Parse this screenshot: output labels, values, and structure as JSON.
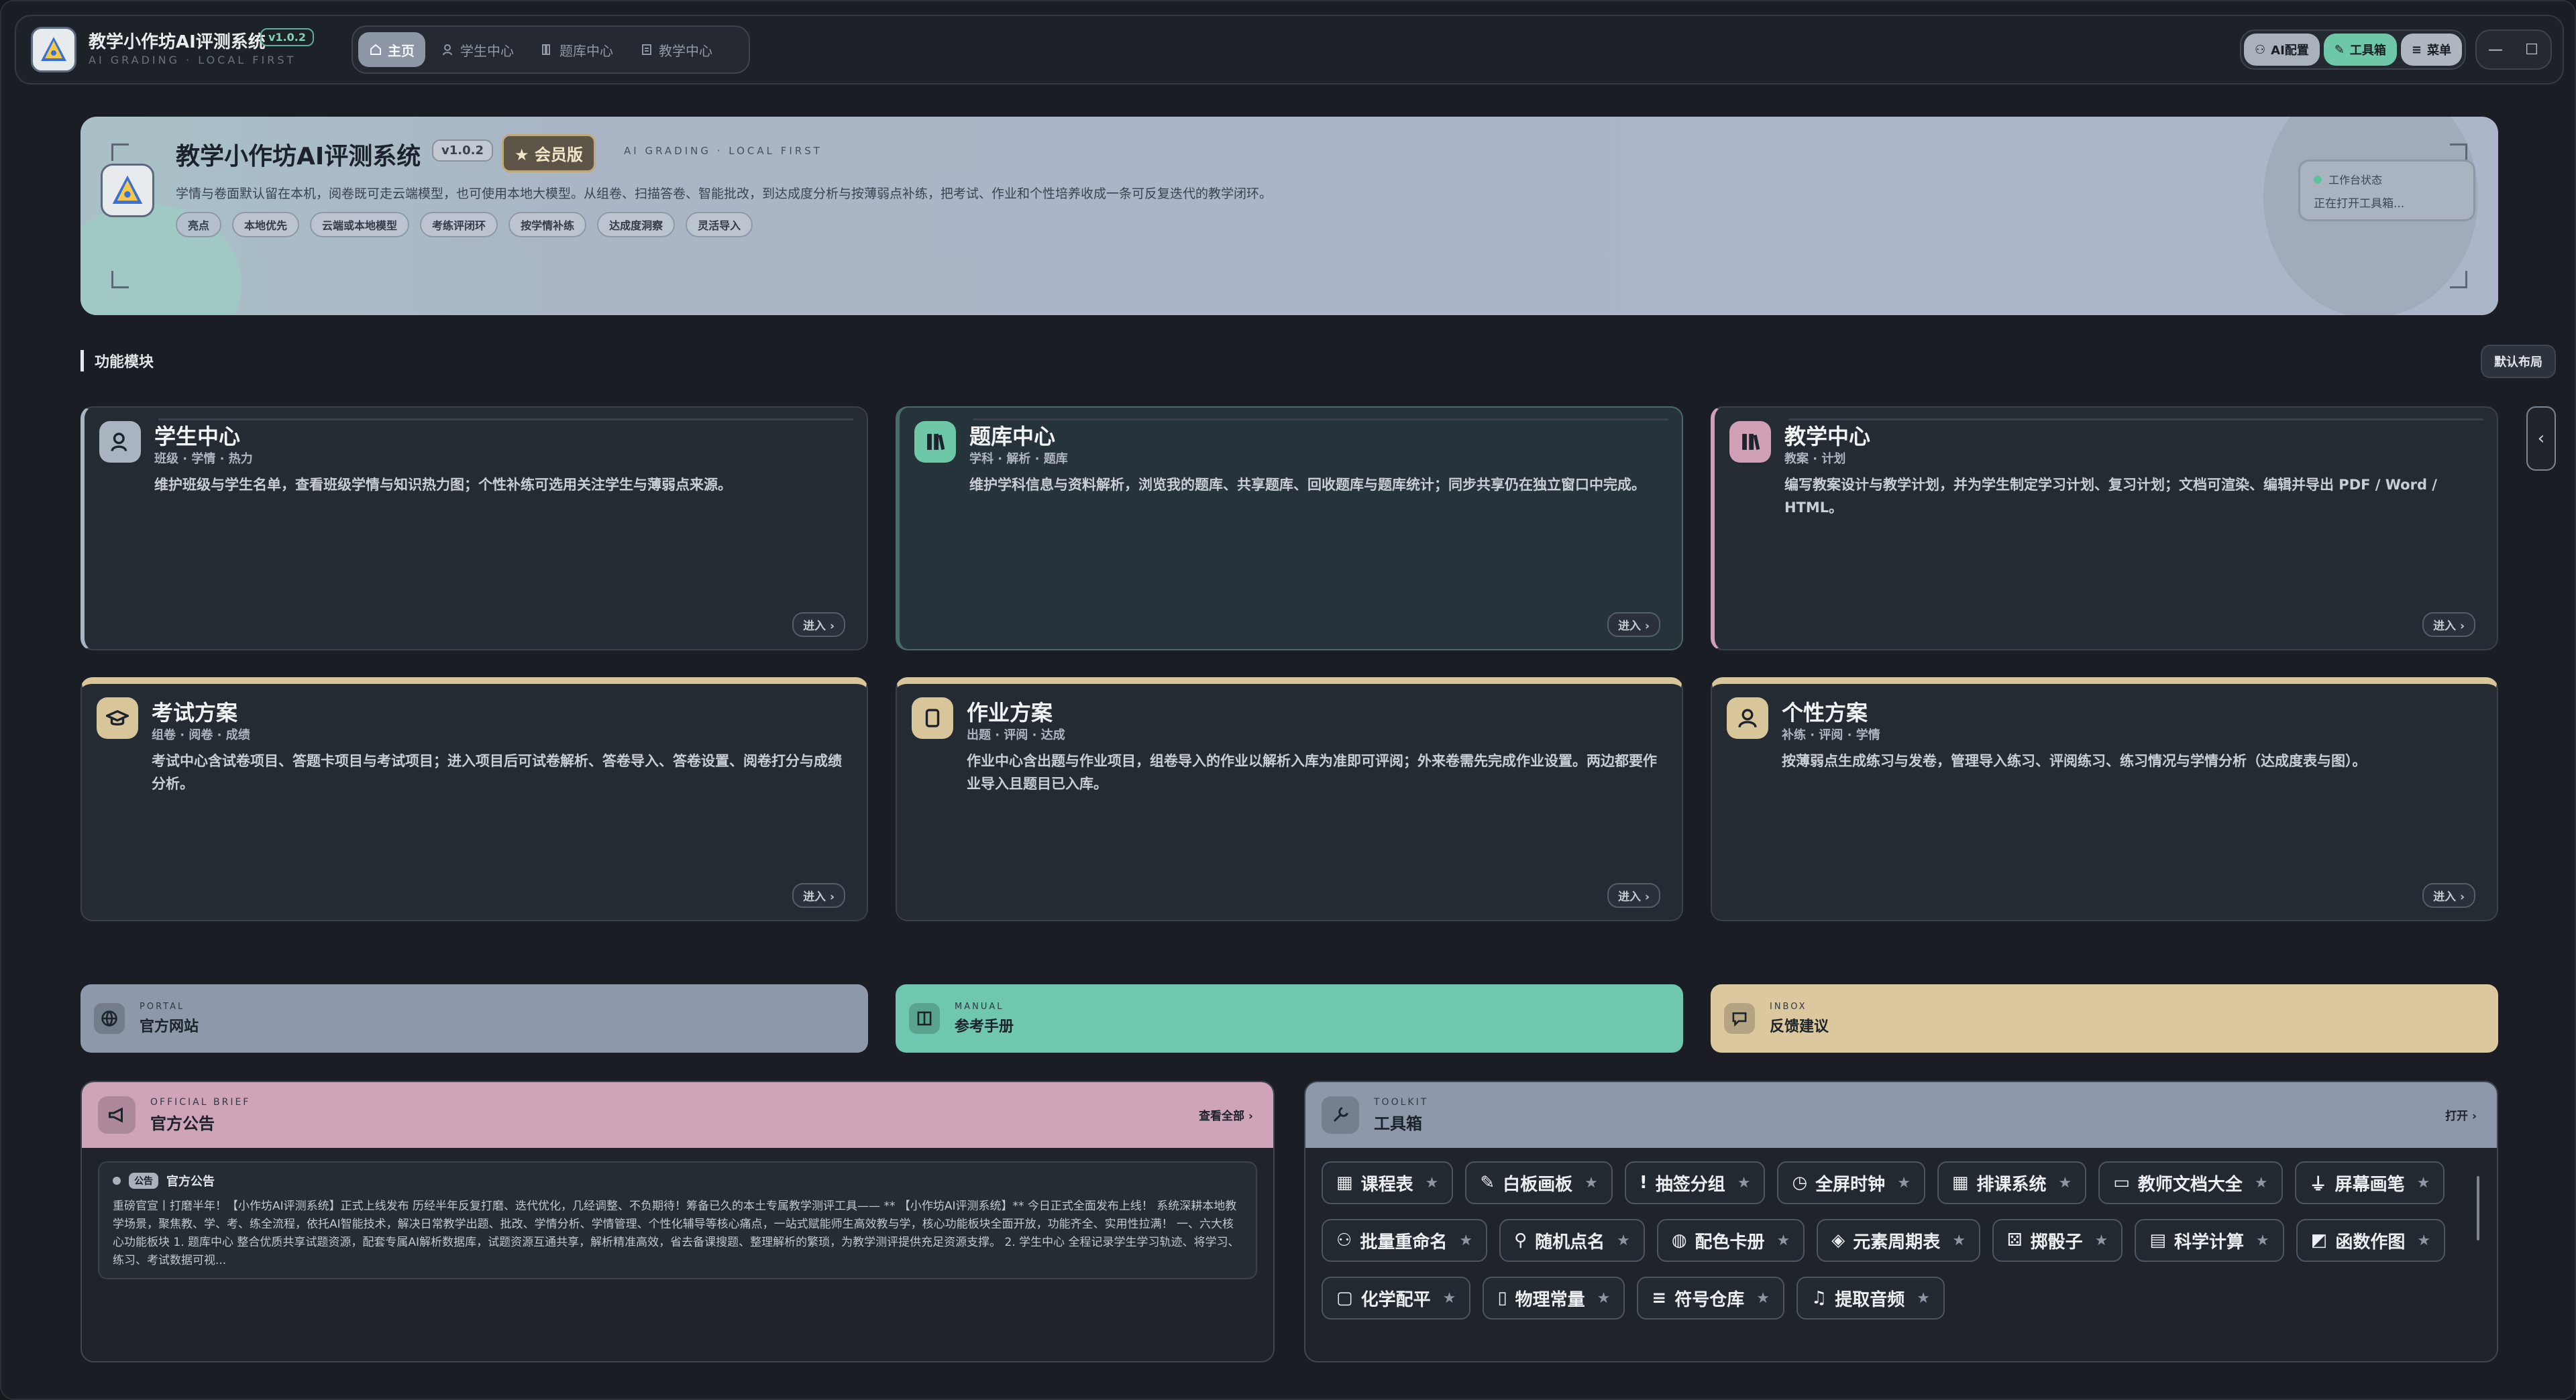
{
  "app": {
    "title": "教学小作坊AI评测系统",
    "version": "v1.0.2",
    "subtitle": "AI GRADING · LOCAL FIRST"
  },
  "nav": {
    "items": [
      {
        "label": "主页",
        "icon": "home-icon",
        "active": true
      },
      {
        "label": "学生中心",
        "icon": "student-icon",
        "active": false
      },
      {
        "label": "题库中心",
        "icon": "books-icon",
        "active": false
      },
      {
        "label": "教学中心",
        "icon": "doc-icon",
        "active": false
      }
    ]
  },
  "toolbar": {
    "ai_config": "AI配置",
    "toolbox": "工具箱",
    "menu": "菜单"
  },
  "hero": {
    "title": "教学小作坊AI评测系统",
    "version": "v1.0.2",
    "vip": "★ 会员版",
    "en": "AI GRADING · LOCAL FIRST",
    "desc": "学情与卷面默认留在本机，阅卷既可走云端模型，也可使用本地大模型。从组卷、扫描答卷、智能批改，到达成度分析与按薄弱点补练，把考试、作业和个性培养收成一条可反复迭代的教学闭环。",
    "tags": [
      "亮点",
      "本地优先",
      "云端或本地模型",
      "考练评闭环",
      "按学情补练",
      "达成度洞察",
      "灵活导入"
    ],
    "status_key": "工作台状态",
    "status_value": "正在打开工具箱..."
  },
  "section": {
    "label": "功能模块",
    "default_layout": "默认布局"
  },
  "modules": [
    {
      "title": "学生中心",
      "sub": "班级 · 学情 · 热力",
      "desc": "维护班级与学生名单，查看班级学情与知识热力图；个性补练可选用关注学生与薄弱点来源。",
      "enter": "进入",
      "icon": "student-icon",
      "color": "#aab3c0"
    },
    {
      "title": "题库中心",
      "sub": "学科 · 解析 · 题库",
      "desc": "维护学科信息与资料解析，浏览我的题库、共享题库、回收题库与题库统计；同步共享仍在独立窗口中完成。",
      "enter": "进入",
      "icon": "books-icon",
      "color": "#6ec7a6"
    },
    {
      "title": "教学中心",
      "sub": "教案 · 计划",
      "desc": "编写教案设计与教学计划，并为学生制定学习计划、复习计划；文档可渲染、编辑并导出 PDF / Word / HTML。",
      "enter": "进入",
      "icon": "books-icon",
      "color": "#cfa0b6"
    },
    {
      "title": "考试方案",
      "sub": "组卷 · 阅卷 · 成绩",
      "desc": "考试中心含试卷项目、答题卡项目与考试项目；进入项目后可试卷解析、答卷导入、答卷设置、阅卷打分与成绩分析。",
      "enter": "进入",
      "icon": "grad-cap-icon",
      "color": "#d9c59a"
    },
    {
      "title": "作业方案",
      "sub": "出题 · 评阅 · 达成",
      "desc": "作业中心含出题与作业项目，组卷导入的作业以解析入库为准即可评阅；外来卷需先完成作业设置。两边都要作业导入且题目已入库。",
      "enter": "进入",
      "icon": "tablet-icon",
      "color": "#d9c59a"
    },
    {
      "title": "个性方案",
      "sub": "补练 · 评阅 · 学情",
      "desc": "按薄弱点生成练习与发卷，管理导入练习、评阅练习、练习情况与学情分析（达成度表与图）。",
      "enter": "进入",
      "icon": "person-icon",
      "color": "#d9c59a"
    }
  ],
  "links": [
    {
      "en": "PORTAL",
      "cn": "官方网站",
      "icon": "globe-icon",
      "color": "#8d98aa"
    },
    {
      "en": "MANUAL",
      "cn": "参考手册",
      "icon": "book-icon",
      "color": "#6ec7ae"
    },
    {
      "en": "INBOX",
      "cn": "反馈建议",
      "icon": "chat-icon",
      "color": "#dcc89e"
    }
  ],
  "announcement": {
    "en": "OFFICIAL BRIEF",
    "cn": "官方公告",
    "view_all": "查看全部",
    "badge": "公告",
    "notice_title": "官方公告",
    "notice_body": "重磅官宣丨打磨半年！【小作坊AI评测系统】正式上线发布 历经半年反复打磨、迭代优化，几经调整、不负期待！筹备已久的本土专属教学测评工具—— ** 【小作坊AI评测系统】** 今日正式全面发布上线！ 系统深耕本地教学场景，聚焦教、学、考、练全流程，依托AI智能技术，解决日常教学出题、批改、学情分析、学情管理、个性化辅导等核心痛点，一站式赋能师生高效教与学，核心功能板块全面开放，功能齐全、实用性拉满！ 一、六大核心功能板块 1. 题库中心 整合优质共享试题资源，配套专属AI解析数据库，试题资源互通共享，解析精准高效，省去备课搜题、整理解析的繁琐，为教学测评提供充足资源支撑。 2. 学生中心 全程记录学生学习轨迹、将学习、练习、考试数据可视..."
  },
  "toolbox": {
    "en": "TOOLKIT",
    "cn": "工具箱",
    "open": "打开",
    "star": "★",
    "items": [
      {
        "label": "课程表",
        "icon": "calendar-icon"
      },
      {
        "label": "白板画板",
        "icon": "pen-icon"
      },
      {
        "label": "抽签分组",
        "icon": "exclaim-icon"
      },
      {
        "label": "全屏时钟",
        "icon": "clock-icon"
      },
      {
        "label": "排课系统",
        "icon": "calendar-icon"
      },
      {
        "label": "教师文档大全",
        "icon": "monitor-icon"
      },
      {
        "label": "屏幕画笔",
        "icon": "funnel-icon"
      },
      {
        "label": "批量重命名",
        "icon": "user-group-icon"
      },
      {
        "label": "随机点名",
        "icon": "user-pick-icon"
      },
      {
        "label": "配色卡册",
        "icon": "palette-icon"
      },
      {
        "label": "元素周期表",
        "icon": "layers-icon"
      },
      {
        "label": "掷骰子",
        "icon": "gamepad-icon"
      },
      {
        "label": "科学计算",
        "icon": "calculator-icon"
      },
      {
        "label": "函数作图",
        "icon": "chart-icon"
      },
      {
        "label": "化学配平",
        "icon": "chip-icon"
      },
      {
        "label": "物理常量",
        "icon": "file-icon"
      },
      {
        "label": "符号仓库",
        "icon": "lines-icon"
      },
      {
        "label": "提取音频",
        "icon": "audio-icon"
      }
    ]
  }
}
